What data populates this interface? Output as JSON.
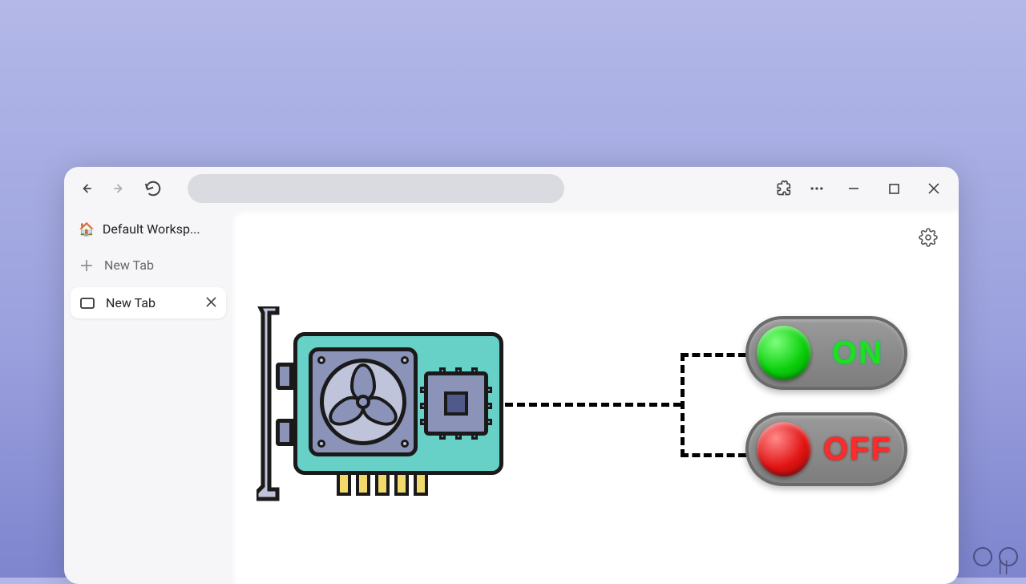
{
  "sidebar": {
    "workspace_icon": "🏠",
    "workspace_label": "Default Worksp...",
    "new_tab_label": "New Tab",
    "tabs": [
      {
        "title": "New Tab"
      }
    ]
  },
  "toolbar": {
    "address_value": ""
  },
  "content": {
    "switch_on_label": "ON",
    "switch_off_label": "OFF"
  }
}
